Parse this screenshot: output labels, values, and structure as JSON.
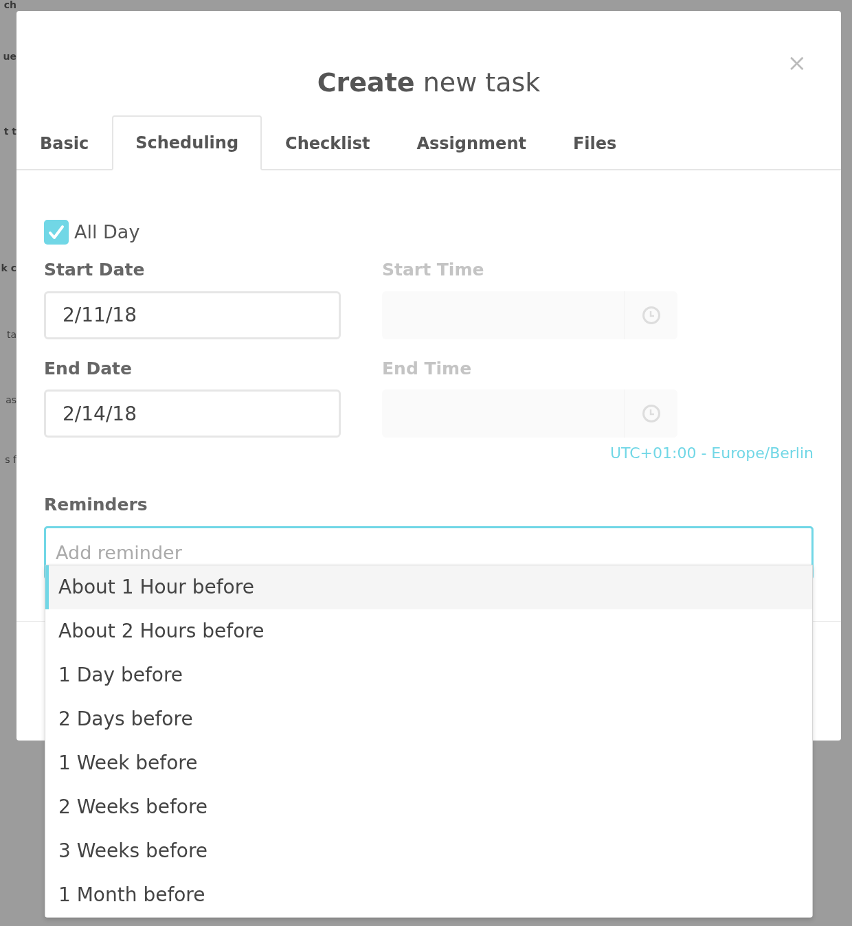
{
  "background": {
    "fragments": [
      "ch",
      "ue",
      "t t",
      "k c",
      "ta",
      "as",
      "s f"
    ]
  },
  "dialog": {
    "title": "**Create** new task",
    "close": "×"
  },
  "tabs": [
    {
      "label": "Basic",
      "selected": false
    },
    {
      "label": "Scheduling",
      "selected": true
    },
    {
      "label": "Checklist",
      "selected": false
    },
    {
      "label": "Assignment",
      "selected": false
    },
    {
      "label": "Files",
      "selected": false
    }
  ],
  "all_day": {
    "label": "All Day",
    "checked": true
  },
  "date_fields": [
    {
      "label": "Start Date",
      "value": "2/11/18"
    },
    {
      "label": "End Date",
      "value": "2/14/18"
    }
  ],
  "time_fields": [
    {
      "label": "Start Time",
      "disabled": true
    },
    {
      "label": "End Time",
      "disabled": true
    }
  ],
  "timezone": "UTC+01:00 - Europe/Berlin",
  "reminders": {
    "label": "Reminders",
    "placeholder": "Add reminder",
    "options": [
      {
        "label": "About 1 Hour before",
        "selected": true
      },
      {
        "label": "About 2 Hours before",
        "selected": false
      },
      {
        "label": "1 Day before",
        "selected": false
      },
      {
        "label": "2 Days before",
        "selected": false
      },
      {
        "label": "1 Week before",
        "selected": false
      },
      {
        "label": "2 Weeks before",
        "selected": false
      },
      {
        "label": "3 Weeks before",
        "selected": false
      },
      {
        "label": "1 Month before",
        "selected": false
      }
    ]
  }
}
